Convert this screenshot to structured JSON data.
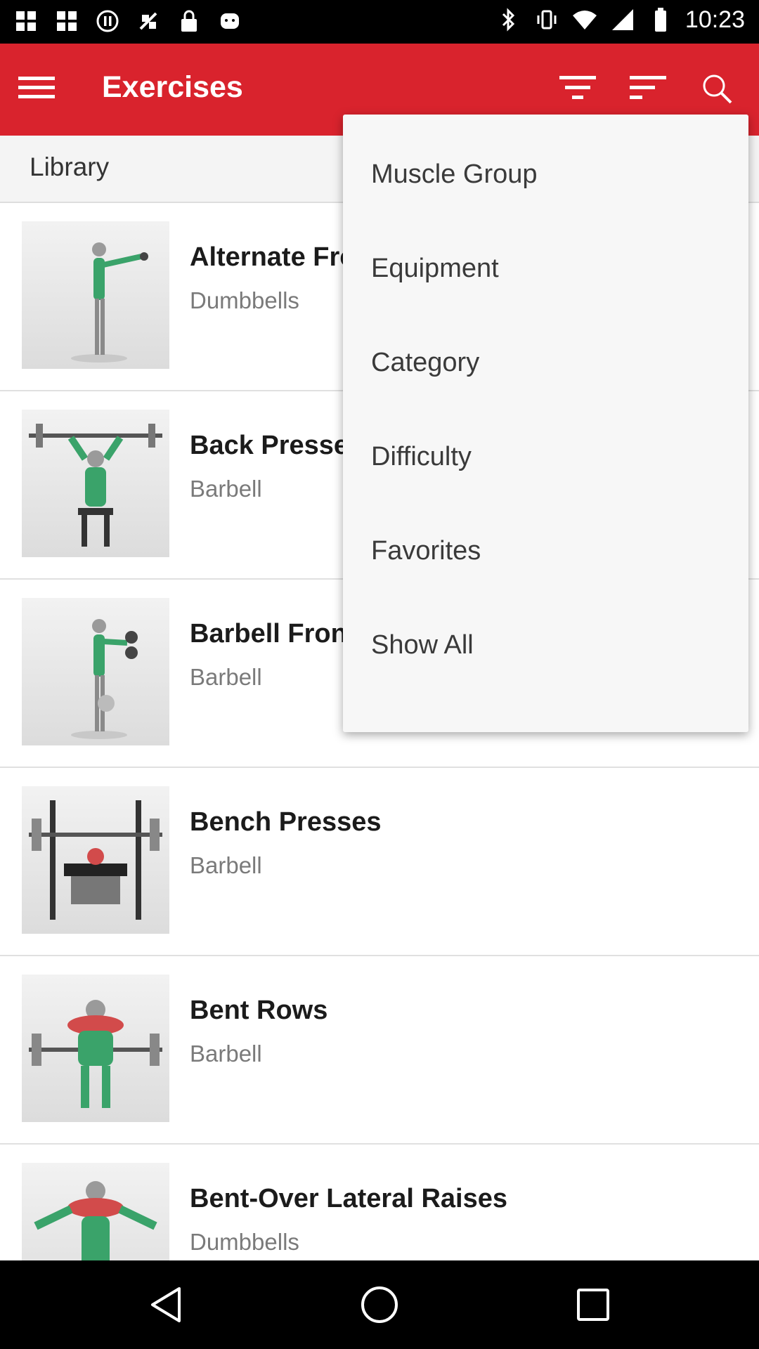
{
  "status_bar": {
    "time": "10:23",
    "left_icons": [
      "grid-icon",
      "grid-icon",
      "pause-circle-icon",
      "no-signal-icon",
      "lock-icon",
      "gamepad-icon"
    ],
    "right_icons": [
      "bluetooth-icon",
      "vibrate-icon",
      "wifi-icon",
      "signal-icon",
      "battery-icon"
    ]
  },
  "app_bar": {
    "title": "Exercises",
    "icons": [
      "menu-icon",
      "filter-icon",
      "sort-icon",
      "search-icon"
    ],
    "color": "#d9232d"
  },
  "tab": {
    "label": "Library"
  },
  "exercises": [
    {
      "name": "Alternate Front Raises",
      "equipment": "Dumbbells"
    },
    {
      "name": "Back Presses",
      "equipment": "Barbell"
    },
    {
      "name": "Barbell Front Raises",
      "equipment": "Barbell"
    },
    {
      "name": "Bench Presses",
      "equipment": "Barbell"
    },
    {
      "name": "Bent Rows",
      "equipment": "Barbell"
    },
    {
      "name": "Bent-Over Lateral Raises",
      "equipment": "Dumbbells"
    }
  ],
  "dropdown": {
    "items": [
      "Muscle Group",
      "Equipment",
      "Category",
      "Difficulty",
      "Favorites",
      "Show All"
    ]
  },
  "nav_bar": {
    "icons": [
      "back-icon",
      "home-icon",
      "recents-icon"
    ]
  }
}
